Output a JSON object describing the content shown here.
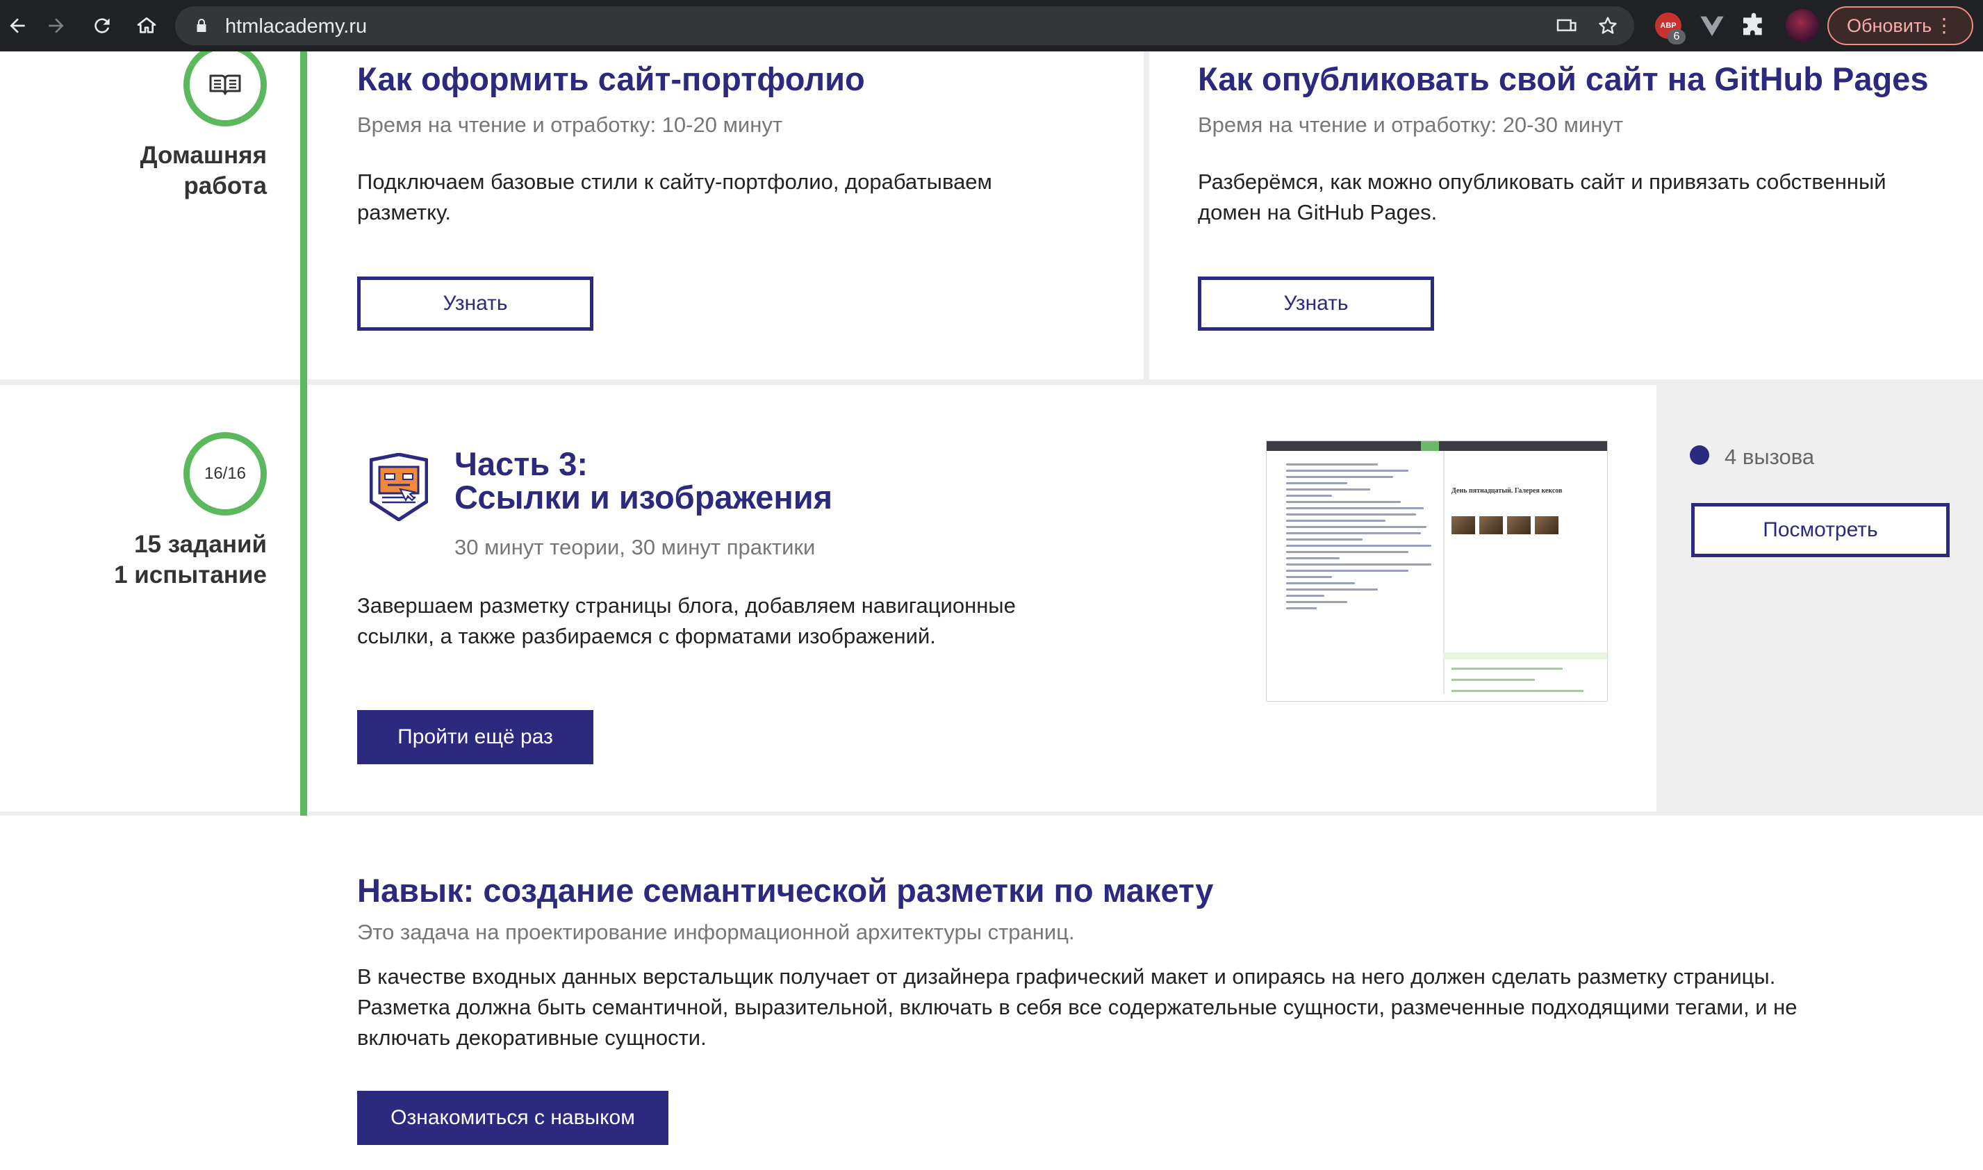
{
  "browser": {
    "url": "htmlacademy.ru",
    "abp_badge": "6",
    "abp_label": "ABP",
    "update_label": "Обновить",
    "update_menu": "⋮"
  },
  "homework": {
    "label_line1": "Домашняя",
    "label_line2": "работа",
    "cards": [
      {
        "title": "Как оформить сайт-портфолио",
        "meta": "Время на чтение и отработку: 10-20 минут",
        "desc": "Подключаем базовые стили к сайту-портфолио, дорабатываем разметку.",
        "button": "Узнать"
      },
      {
        "title": "Как опубликовать свой сайт на GitHub Pages",
        "meta": "Время на чтение и отработку: 20-30 минут",
        "desc": "Разберёмся, как можно опубликовать сайт и привязать собственный домен на GitHub Pages.",
        "button": "Узнать"
      }
    ]
  },
  "part3": {
    "progress": "16/16",
    "tasks": "15 заданий",
    "trials": "1 испытание",
    "title_line1": "Часть 3:",
    "title_line2": "Ссылки и изображения",
    "meta": "30 минут теории, 30 минут практики",
    "desc": "Завершаем разметку страницы блога, добавляем навигационные ссылки, а также разбираемся с форматами изображений.",
    "button": "Пройти ещё раз",
    "preview_heading": "День пятнадцатый. Галерея кексов",
    "challenges": "4 вызова",
    "view_button": "Посмотреть"
  },
  "skill": {
    "title": "Навык: создание семантической разметки по макету",
    "subtitle": "Это задача на проектирование информационной архитектуры страниц.",
    "desc": "В качестве входных данных верстальщик получает от дизайнера графический макет и опираясь на него должен сделать разметку страницы. Разметка должна быть семантичной, выразительной, включать в себя все содержательные сущности, размеченные подходящими тегами, и не включать декоративные сущности.",
    "button": "Ознакомиться с навыком"
  },
  "colors": {
    "brand": "#2b2a7e",
    "timeline": "#5cb85c"
  }
}
